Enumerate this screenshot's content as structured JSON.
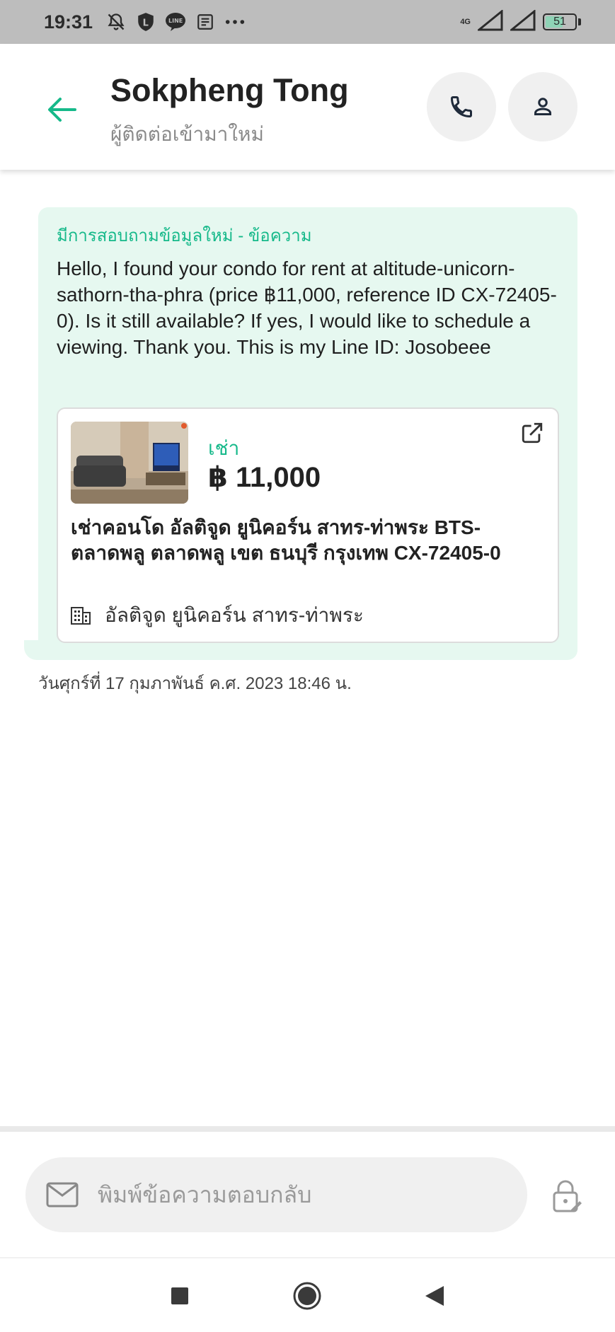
{
  "status_bar": {
    "time": "19:31",
    "network_label": "4G",
    "battery": "51",
    "icons": [
      "mute-bell-icon",
      "shield-icon",
      "line-app-icon",
      "news-icon",
      "more-dots-icon",
      "signal-icon",
      "signal-icon",
      "battery-icon"
    ]
  },
  "header": {
    "name": "Sokpheng Tong",
    "subtitle": "ผู้ติดต่อเข้ามาใหม่",
    "accent": "#16b98a"
  },
  "message": {
    "label": "มีการสอบถามข้อมูลใหม่ - ข้อความ",
    "text": "Hello, I found your condo for rent at altitude-unicorn-sathorn-tha-phra (price ฿11,000, reference ID CX-72405-0). Is it still available? If yes, I would like to schedule a viewing. Thank you. This is my Line ID: Josobeee",
    "time": "วันศุกร์ที่ 17 กุมภาพันธ์ ค.ศ. 2023 18:46 น.",
    "bubble_color": "#e6f8f0"
  },
  "listing": {
    "type": "เช่า",
    "price": "฿ 11,000",
    "title": "เช่าคอนโด   อัลติจูด ยูนิคอร์น สาทร-ท่าพระ  BTS-ตลาดพลู ตลาดพลู เขต ธนบุรี กรุงเทพ CX-72405-0",
    "location": "อัลติจูด ยูนิคอร์น สาทร-ท่าพระ"
  },
  "reply": {
    "placeholder": "พิมพ์ข้อความตอบกลับ"
  }
}
